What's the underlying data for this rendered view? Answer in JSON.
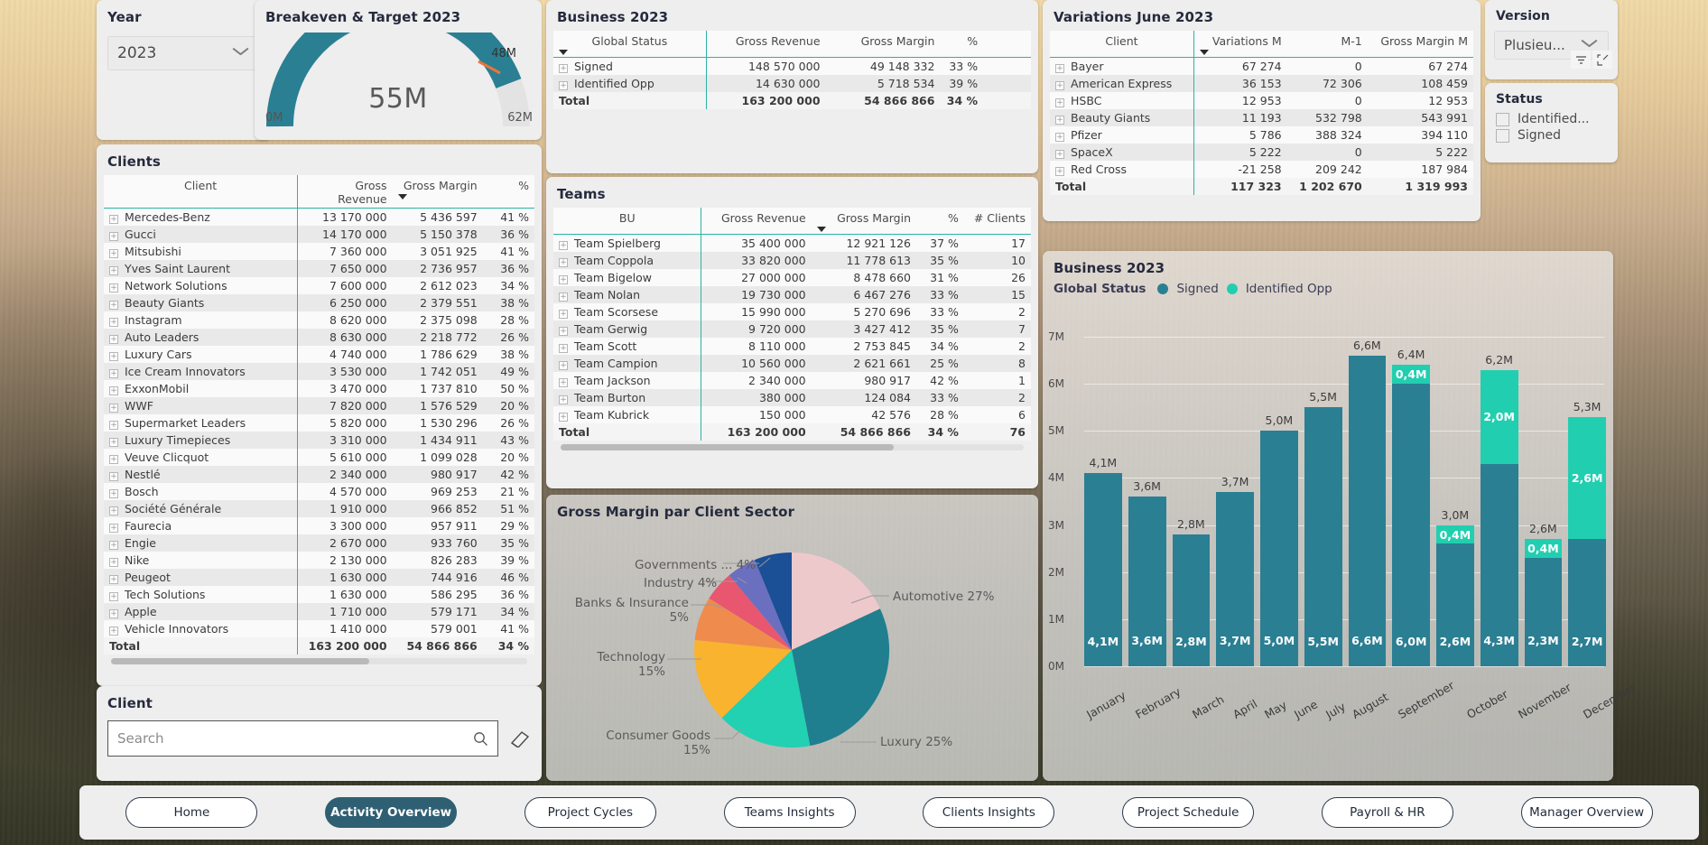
{
  "year_slicer": {
    "title": "Year",
    "value": "2023",
    "icon": "chevron-down-icon"
  },
  "gauge": {
    "title": "Breakeven & Target 2023",
    "value": "55M",
    "min": "0M",
    "max": "62M",
    "target": "48M",
    "color_fill": "#2a7f93",
    "color_target": "#e8763a",
    "numeric": {
      "value": 55,
      "min": 0,
      "max": 62,
      "target": 48
    }
  },
  "clients_panel": {
    "title": "Clients",
    "columns": [
      "Client",
      "Gross Revenue",
      "Gross Margin",
      "%"
    ],
    "sorted_by": "Gross Margin",
    "rows": [
      {
        "client": "Mercedes-Benz",
        "revenue": "13 170 000",
        "margin": "5 436 597",
        "pct": "41 %"
      },
      {
        "client": "Gucci",
        "revenue": "14 170 000",
        "margin": "5 150 378",
        "pct": "36 %"
      },
      {
        "client": "Mitsubishi",
        "revenue": "7 360 000",
        "margin": "3 051 925",
        "pct": "41 %"
      },
      {
        "client": "Yves Saint Laurent",
        "revenue": "7 650 000",
        "margin": "2 736 957",
        "pct": "36 %"
      },
      {
        "client": "Network Solutions",
        "revenue": "7 600 000",
        "margin": "2 612 023",
        "pct": "34 %"
      },
      {
        "client": "Beauty Giants",
        "revenue": "6 250 000",
        "margin": "2 379 551",
        "pct": "38 %"
      },
      {
        "client": "Instagram",
        "revenue": "8 620 000",
        "margin": "2 375 098",
        "pct": "28 %"
      },
      {
        "client": "Auto Leaders",
        "revenue": "8 630 000",
        "margin": "2 218 772",
        "pct": "26 %"
      },
      {
        "client": "Luxury Cars",
        "revenue": "4 740 000",
        "margin": "1 786 629",
        "pct": "38 %"
      },
      {
        "client": "Ice Cream Innovators",
        "revenue": "3 530 000",
        "margin": "1 742 051",
        "pct": "49 %"
      },
      {
        "client": "ExxonMobil",
        "revenue": "3 470 000",
        "margin": "1 737 810",
        "pct": "50 %"
      },
      {
        "client": "WWF",
        "revenue": "7 820 000",
        "margin": "1 576 529",
        "pct": "20 %"
      },
      {
        "client": "Supermarket Leaders",
        "revenue": "5 820 000",
        "margin": "1 530 296",
        "pct": "26 %"
      },
      {
        "client": "Luxury Timepieces",
        "revenue": "3 310 000",
        "margin": "1 434 911",
        "pct": "43 %"
      },
      {
        "client": "Veuve Clicquot",
        "revenue": "5 610 000",
        "margin": "1 099 028",
        "pct": "20 %"
      },
      {
        "client": "Nestlé",
        "revenue": "2 340 000",
        "margin": "980 917",
        "pct": "42 %"
      },
      {
        "client": "Bosch",
        "revenue": "4 570 000",
        "margin": "969 253",
        "pct": "21 %"
      },
      {
        "client": "Société Générale",
        "revenue": "1 910 000",
        "margin": "966 852",
        "pct": "51 %"
      },
      {
        "client": "Faurecia",
        "revenue": "3 300 000",
        "margin": "957 911",
        "pct": "29 %"
      },
      {
        "client": "Engie",
        "revenue": "2 670 000",
        "margin": "933 760",
        "pct": "35 %"
      },
      {
        "client": "Nike",
        "revenue": "2 130 000",
        "margin": "826 283",
        "pct": "39 %"
      },
      {
        "client": "Peugeot",
        "revenue": "1 630 000",
        "margin": "744 916",
        "pct": "46 %"
      },
      {
        "client": "Tech Solutions",
        "revenue": "1 630 000",
        "margin": "586 295",
        "pct": "36 %"
      },
      {
        "client": "Apple",
        "revenue": "1 710 000",
        "margin": "579 171",
        "pct": "34 %"
      },
      {
        "client": "Vehicle Innovators",
        "revenue": "1 410 000",
        "margin": "579 001",
        "pct": "41 %"
      }
    ],
    "total": {
      "client": "Total",
      "revenue": "163 200 000",
      "margin": "54 866 866",
      "pct": "34 %"
    }
  },
  "client_search": {
    "title": "Client",
    "placeholder": "Search",
    "value": "",
    "search_icon": "search-icon",
    "clear_icon": "eraser-icon"
  },
  "business_table": {
    "title": "Business 2023",
    "columns": [
      "Global Status",
      "Gross Revenue",
      "Gross Margin",
      "%"
    ],
    "sorted_by": "Global Status",
    "rows": [
      {
        "status": "Signed",
        "revenue": "148 570 000",
        "margin": "49 148 332",
        "pct": "33 %"
      },
      {
        "status": "Identified Opp",
        "revenue": "14 630 000",
        "margin": "5 718 534",
        "pct": "39 %"
      }
    ],
    "total": {
      "status": "Total",
      "revenue": "163 200 000",
      "margin": "54 866 866",
      "pct": "34 %"
    }
  },
  "teams_table": {
    "title": "Teams",
    "columns": [
      "BU",
      "Gross Revenue",
      "Gross Margin",
      "%",
      "# Clients"
    ],
    "sorted_by": "Gross Margin",
    "rows": [
      {
        "bu": "Team Spielberg",
        "revenue": "35 400 000",
        "margin": "12 921 126",
        "pct": "37 %",
        "clients": "17"
      },
      {
        "bu": "Team Coppola",
        "revenue": "33 820 000",
        "margin": "11 778 613",
        "pct": "35 %",
        "clients": "10"
      },
      {
        "bu": "Team Bigelow",
        "revenue": "27 000 000",
        "margin": "8 478 660",
        "pct": "31 %",
        "clients": "26"
      },
      {
        "bu": "Team Nolan",
        "revenue": "19 730 000",
        "margin": "6 467 276",
        "pct": "33 %",
        "clients": "15"
      },
      {
        "bu": "Team Scorsese",
        "revenue": "15 990 000",
        "margin": "5 270 696",
        "pct": "33 %",
        "clients": "2"
      },
      {
        "bu": "Team Gerwig",
        "revenue": "9 720 000",
        "margin": "3 427 412",
        "pct": "35 %",
        "clients": "7"
      },
      {
        "bu": "Team Scott",
        "revenue": "8 110 000",
        "margin": "2 753 845",
        "pct": "34 %",
        "clients": "2"
      },
      {
        "bu": "Team Campion",
        "revenue": "10 560 000",
        "margin": "2 621 661",
        "pct": "25 %",
        "clients": "8"
      },
      {
        "bu": "Team Jackson",
        "revenue": "2 340 000",
        "margin": "980 917",
        "pct": "42 %",
        "clients": "1"
      },
      {
        "bu": "Team Burton",
        "revenue": "380 000",
        "margin": "124 084",
        "pct": "33 %",
        "clients": "2"
      },
      {
        "bu": "Team Kubrick",
        "revenue": "150 000",
        "margin": "42 576",
        "pct": "28 %",
        "clients": "6"
      }
    ],
    "total": {
      "bu": "Total",
      "revenue": "163 200 000",
      "margin": "54 866 866",
      "pct": "34 %",
      "clients": "76"
    }
  },
  "variations_table": {
    "title": "Variations June 2023",
    "columns": [
      "Client",
      "Variations M",
      "M-1",
      "Gross Margin M"
    ],
    "sorted_by": "Variations M",
    "rows": [
      {
        "client": "Bayer",
        "var": "67 274",
        "m1": "0",
        "gm": "67 274"
      },
      {
        "client": "American Express",
        "var": "36 153",
        "m1": "72 306",
        "gm": "108 459"
      },
      {
        "client": "HSBC",
        "var": "12 953",
        "m1": "0",
        "gm": "12 953"
      },
      {
        "client": "Beauty Giants",
        "var": "11 193",
        "m1": "532 798",
        "gm": "543 991"
      },
      {
        "client": "Pfizer",
        "var": "5 786",
        "m1": "388 324",
        "gm": "394 110"
      },
      {
        "client": "SpaceX",
        "var": "5 222",
        "m1": "0",
        "gm": "5 222"
      },
      {
        "client": "Red Cross",
        "var": "-21 258",
        "m1": "209 242",
        "gm": "187 984"
      }
    ],
    "total": {
      "client": "Total",
      "var": "117 323",
      "m1": "1 202 670",
      "gm": "1 319 993"
    }
  },
  "version_panel": {
    "title": "Version",
    "value": "Plusieu...",
    "chevron_icon": "chevron-down-icon",
    "filter_icon": "filter-icon",
    "expand_icon": "focus-mode-icon"
  },
  "status_panel": {
    "title": "Status",
    "items": [
      {
        "label": "Identified...",
        "checked": false
      },
      {
        "label": "Signed",
        "checked": false
      }
    ]
  },
  "chart_data": [
    {
      "id": "business-2023-bar",
      "type": "bar",
      "title": "Business 2023",
      "legend_title": "Global Status",
      "legend_position": "top",
      "stacked": true,
      "grid": true,
      "xlabel": "",
      "ylabel": "",
      "ylim": [
        0,
        7
      ],
      "yticks": [
        "0M",
        "1M",
        "2M",
        "3M",
        "4M",
        "5M",
        "6M",
        "7M"
      ],
      "categories": [
        "January",
        "February",
        "March",
        "April",
        "May",
        "June",
        "July",
        "August",
        "September",
        "October",
        "November",
        "December"
      ],
      "series": [
        {
          "name": "Signed",
          "color": "#2a7f93",
          "values": [
            4.1,
            3.6,
            2.8,
            3.7,
            5.0,
            5.5,
            6.6,
            6.0,
            2.6,
            4.3,
            2.3,
            2.7
          ],
          "labels": [
            "4,1M",
            "3,6M",
            "2,8M",
            "3,7M",
            "5,0M",
            "5,5M",
            "6,6M",
            "6,0M",
            "2,6M",
            "4,3M",
            "2,3M",
            "2,7M"
          ]
        },
        {
          "name": "Identified Opp",
          "color": "#21cfb0",
          "values": [
            0,
            0,
            0,
            0,
            0,
            0,
            0,
            0.4,
            0.4,
            2.0,
            0.4,
            2.6
          ],
          "labels": [
            "",
            "",
            "",
            "",
            "",
            "",
            "",
            "0,4M",
            "0,4M",
            "2,0M",
            "0,4M",
            "2,6M"
          ]
        }
      ],
      "total_labels": [
        "4,1M",
        "3,6M",
        "2,8M",
        "3,7M",
        "5,0M",
        "5,5M",
        "6,6M",
        "6,4M",
        "3,0M",
        "6,2M",
        "2,6M",
        "5,3M"
      ]
    },
    {
      "id": "gross-margin-sector-pie",
      "type": "pie",
      "title": "Gross Margin par Client Sector",
      "legend_position": "callout-labels",
      "labels": [
        "Automotive",
        "Luxury",
        "Consumer Goods",
        "Technology",
        "Banks & Insurance",
        "Industry",
        "Governments ..."
      ],
      "values": [
        27,
        25,
        15,
        15,
        5,
        4,
        4
      ],
      "display": [
        "Automotive 27%",
        "Luxury 25%",
        "Consumer Goods\n15%",
        "Technology\n15%",
        "Banks & Insurance\n5%",
        "Industry 4%",
        "Governments ... 4%"
      ],
      "colors": [
        "#eec9cc",
        "#1f7f8f",
        "#22d0b2",
        "#f9b32e",
        "#ef8c4d",
        "#e8566f",
        "#6b6fc0",
        "#1b4f96"
      ],
      "extra_color": "#1b4f96"
    }
  ],
  "pie_panel": {
    "title": "Gross Margin par Client Sector"
  },
  "bar_panel": {
    "title": "Business 2023",
    "legend_title": "Global Status"
  },
  "navbar": {
    "buttons": [
      {
        "label": "Home",
        "active": false
      },
      {
        "label": "Activity Overview",
        "active": true
      },
      {
        "label": "Project Cycles",
        "active": false
      },
      {
        "label": "Teams Insights",
        "active": false
      },
      {
        "label": "Clients Insights",
        "active": false
      },
      {
        "label": "Project Schedule",
        "active": false
      },
      {
        "label": "Payroll & HR",
        "active": false
      },
      {
        "label": "Manager Overview",
        "active": false
      }
    ]
  }
}
